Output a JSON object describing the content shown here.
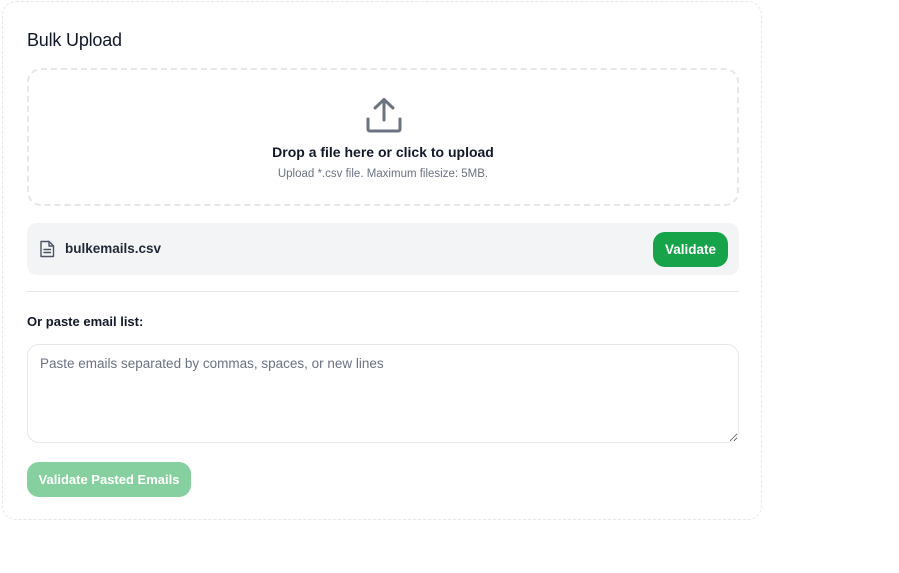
{
  "card": {
    "title": "Bulk Upload"
  },
  "dropzone": {
    "icon": "upload-icon",
    "title": "Drop a file here or click to upload",
    "subtitle": "Upload *.csv file. Maximum filesize: 5MB."
  },
  "file": {
    "icon": "file-text-icon",
    "name": "bulkemails.csv",
    "validate_label": "Validate"
  },
  "paste": {
    "label": "Or paste email list:",
    "placeholder": "Paste emails separated by commas, spaces, or new lines",
    "value": "",
    "button_label": "Validate Pasted Emails",
    "button_disabled": true
  },
  "colors": {
    "primary_green": "#16a34a",
    "disabled_green": "#86d0a0",
    "file_row_bg": "#f3f4f6",
    "border": "#e5e7eb"
  }
}
